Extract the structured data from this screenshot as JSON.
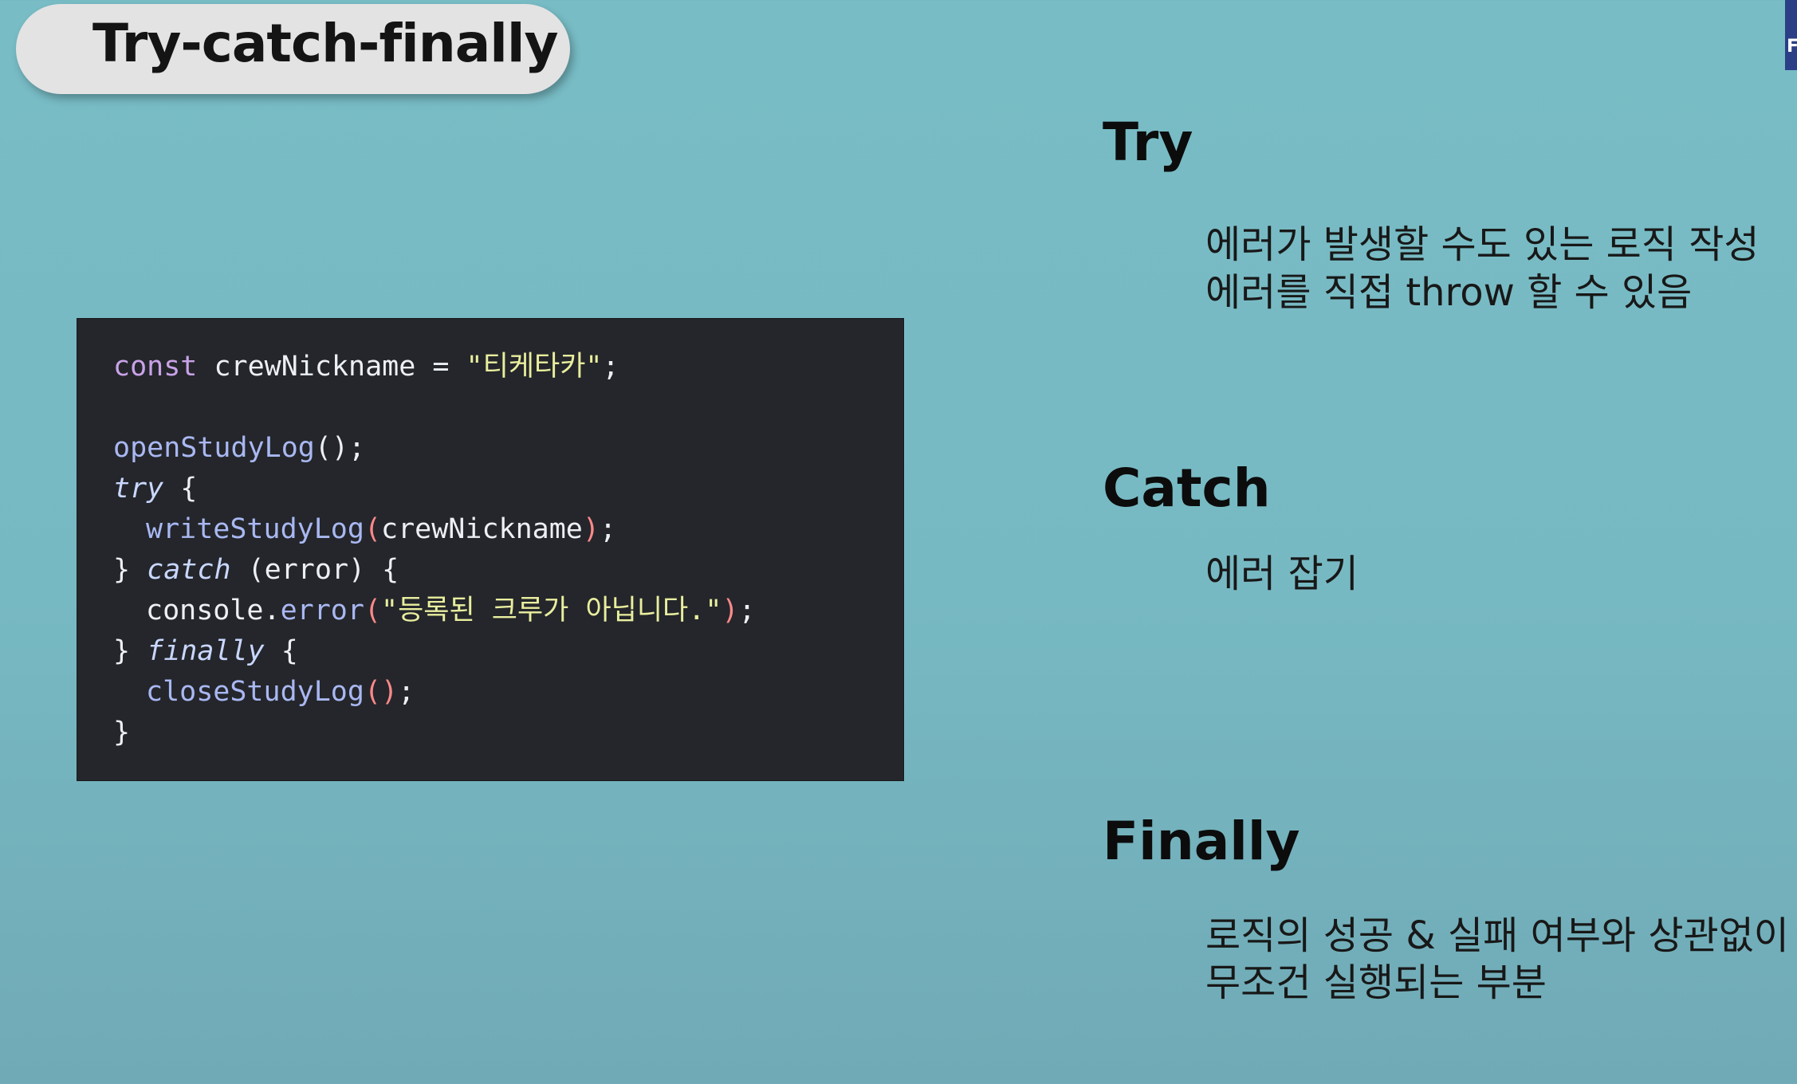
{
  "slide": {
    "title": "Try-catch-finally",
    "corner_tab_label": "F"
  },
  "code": {
    "line1": {
      "keyword": "const",
      "name": "crewNickname",
      "op": "=",
      "string": "\"티케타카\"",
      "end": ";"
    },
    "line2": {
      "fn": "openStudyLog",
      "call": "();"
    },
    "line3": {
      "keyword": "try",
      "brace": "{"
    },
    "line4": {
      "fn": "writeStudyLog",
      "open": "(",
      "arg": "crewNickname",
      "close": ")",
      "end": ";"
    },
    "line5": {
      "brace_close": "}",
      "keyword": "catch",
      "params": "(error) {"
    },
    "line6": {
      "object": "console",
      "dot": ".",
      "method": "error",
      "open": "(",
      "string": "\"등록된 크루가 아닙니다.\"",
      "close": ")",
      "end": ";"
    },
    "line7": {
      "brace_close": "}",
      "keyword": "finally",
      "brace": "{"
    },
    "line8": {
      "fn": "closeStudyLog",
      "parens": "()",
      "end": ";"
    },
    "line9": {
      "brace_close": "}"
    }
  },
  "sections": {
    "try": {
      "heading": "Try",
      "line1": "에러가 발생할 수도 있는 로직 작성",
      "line2": "에러를  직접 throw 할 수 있음"
    },
    "catch": {
      "heading": "Catch",
      "line1": "에러 잡기"
    },
    "finally": {
      "heading": "Finally",
      "line1": "로직의 성공 & 실패 여부와 상관없이",
      "line2": "무조건 실행되는 부분"
    }
  }
}
